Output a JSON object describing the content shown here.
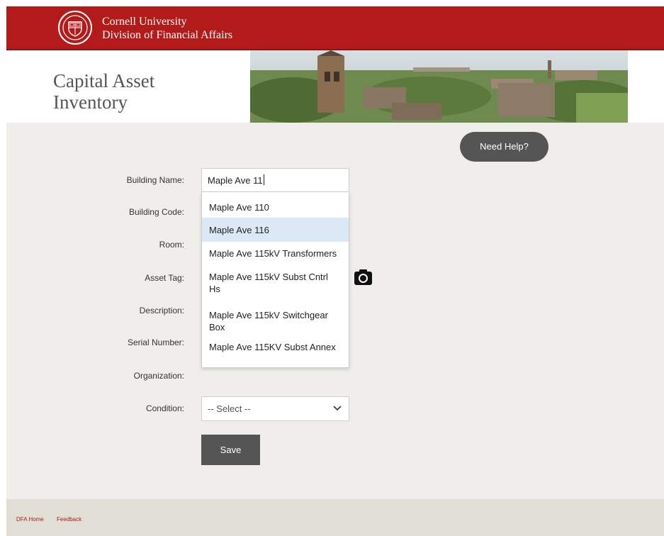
{
  "header": {
    "university": "Cornell University",
    "division": "Division of Financial Affairs",
    "brand_color": "#b31b1b"
  },
  "banner": {
    "title_line1": "Capital Asset",
    "title_line2": "Inventory"
  },
  "help_button": {
    "label": "Need Help?"
  },
  "form": {
    "labels": {
      "building_name": "Building Name:",
      "building_code": "Building Code:",
      "room": "Room:",
      "asset_tag": "Asset Tag:",
      "description": "Description:",
      "serial_number": "Serial Number:",
      "organization": "Organization:",
      "condition": "Condition:"
    },
    "building_name_value": "Maple Ave 11",
    "autocomplete": [
      {
        "line1": "Maple Ave 110",
        "line2": ""
      },
      {
        "line1": "Maple Ave 116",
        "line2": ""
      },
      {
        "line1": "Maple Ave 115kV Transformers",
        "line2": ""
      },
      {
        "line1": "Maple Ave 115kV Subst Cntrl",
        "line2": "Hs"
      },
      {
        "line1": "Maple Ave 115kV Switchgear",
        "line2": "Box"
      },
      {
        "line1": "Maple Ave 115KV Subst Annex",
        "line2": ""
      }
    ],
    "highlighted_index": 1,
    "camera_icon": "camera-icon",
    "condition_selected": "-- Select --",
    "save_label": "Save"
  },
  "footer": {
    "links": [
      "DFA Home",
      "Feedback"
    ]
  }
}
